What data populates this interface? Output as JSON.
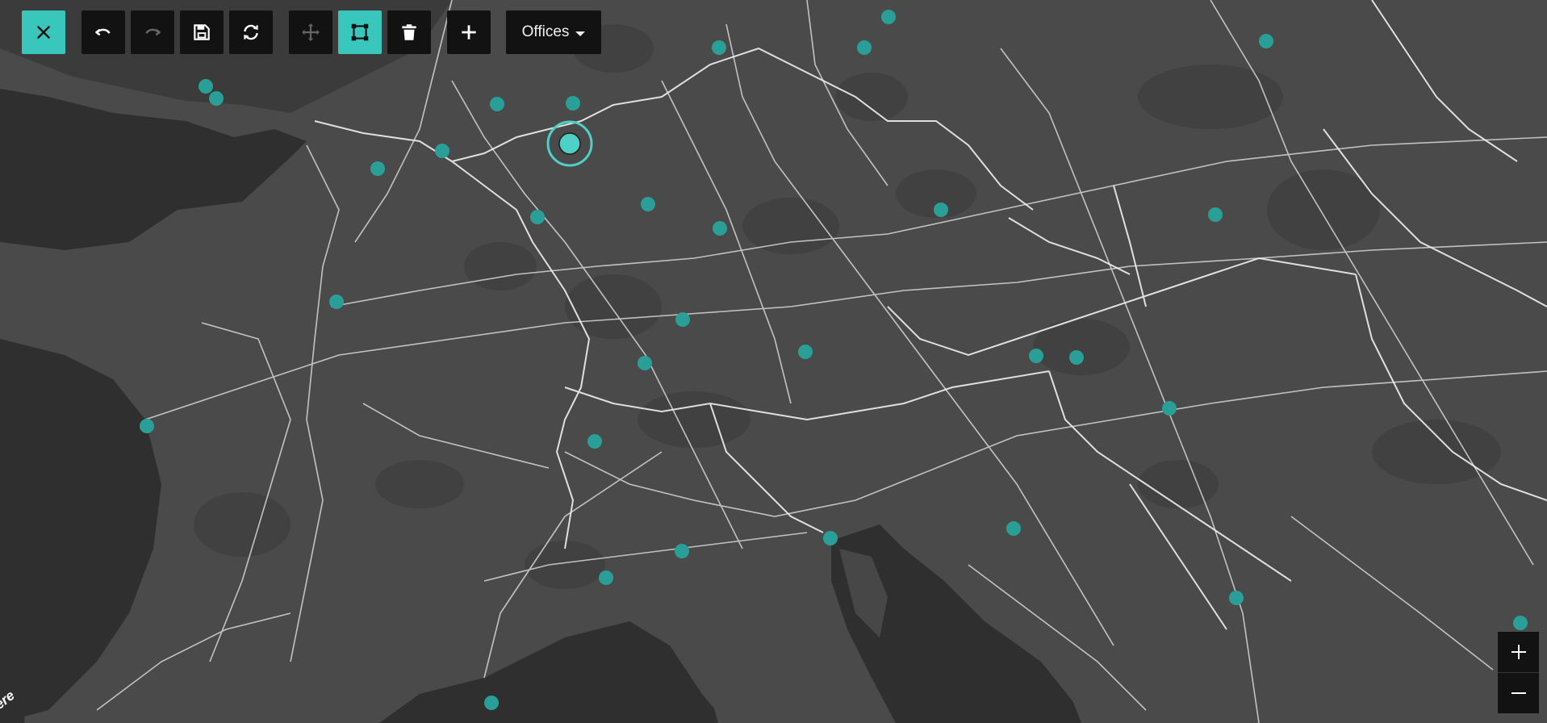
{
  "map": {
    "land_color": "#4a4a4a",
    "sea_color": "#2f2f2f",
    "forest_color": "#414141",
    "road_color": "#d8d8d8",
    "border_color": "#f0f0f0",
    "marker_color": "#2a9f98",
    "selected_marker_color": "#4fd0c6",
    "markers_count": 34
  },
  "toolbar": {
    "close_icon": "close-icon",
    "undo_icon": "undo-icon",
    "redo_icon": "redo-icon",
    "save_icon": "save-icon",
    "refresh_icon": "refresh-icon",
    "move_icon": "move-icon",
    "select_icon": "bounding-box-icon",
    "delete_icon": "trash-icon",
    "add_icon": "plus-icon",
    "layer_label": "Offices",
    "accent_color": "#39c7bd"
  },
  "zoom": {
    "in_icon": "plus-icon",
    "out_icon": "minus-icon"
  },
  "attribution": "here"
}
